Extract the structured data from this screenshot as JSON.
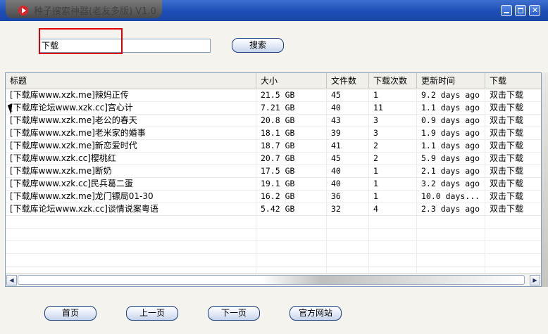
{
  "window": {
    "title": "种子搜索神器(老友多版) V1.0",
    "icon": "media-play-icon",
    "controls": [
      "minimize-icon",
      "maximize-icon",
      "close-icon"
    ]
  },
  "search": {
    "value": "下载",
    "button_label": "搜索"
  },
  "table": {
    "columns": [
      "标题",
      "大小",
      "文件数",
      "下载次数",
      "更新时间",
      "下载"
    ],
    "rows": [
      [
        "[下载库www.xzk.me]辣妈正传",
        "21.5 GB",
        "45",
        "1",
        "9.2 days ago",
        "双击下载"
      ],
      [
        "[下载库论坛www.xzk.cc]宫心计",
        "7.21 GB",
        "40",
        "11",
        "1.1 days ago",
        "双击下载"
      ],
      [
        "[下载库www.xzk.me]老公的春天",
        "20.8 GB",
        "43",
        "3",
        "0.9 days ago",
        "双击下载"
      ],
      [
        "[下载库www.xzk.me]老米家的婚事",
        "18.1 GB",
        "39",
        "3",
        "1.9 days ago",
        "双击下载"
      ],
      [
        "[下载库www.xzk.me]新恋爱时代",
        "18.7 GB",
        "41",
        "2",
        "1.1 days ago",
        "双击下载"
      ],
      [
        "[下载库www.xzk.cc]樱桃红",
        "20.7 GB",
        "45",
        "2",
        "5.9 days ago",
        "双击下载"
      ],
      [
        "[下载库www.xzk.me]断奶",
        "17.5 GB",
        "40",
        "1",
        "2.1 days ago",
        "双击下载"
      ],
      [
        "[下载库www.xzk.cc]民兵葛二蛋",
        "19.1 GB",
        "40",
        "1",
        "3.2 days ago",
        "双击下载"
      ],
      [
        "[下载库www.xzk.me]龙门镖局01-30",
        "16.2 GB",
        "36",
        "1",
        "10.0 days...",
        "双击下载"
      ],
      [
        "[下载库论坛www.xzk.cc]谈情说案粤语",
        "5.42 GB",
        "32",
        "4",
        "2.3 days ago",
        "双击下载"
      ]
    ]
  },
  "pagination": {
    "first": "首页",
    "prev": "上一页",
    "next": "下一页",
    "site": "官方网站"
  },
  "colors": {
    "titlebar": "#1d4db5",
    "highlight_box": "#e00000"
  }
}
